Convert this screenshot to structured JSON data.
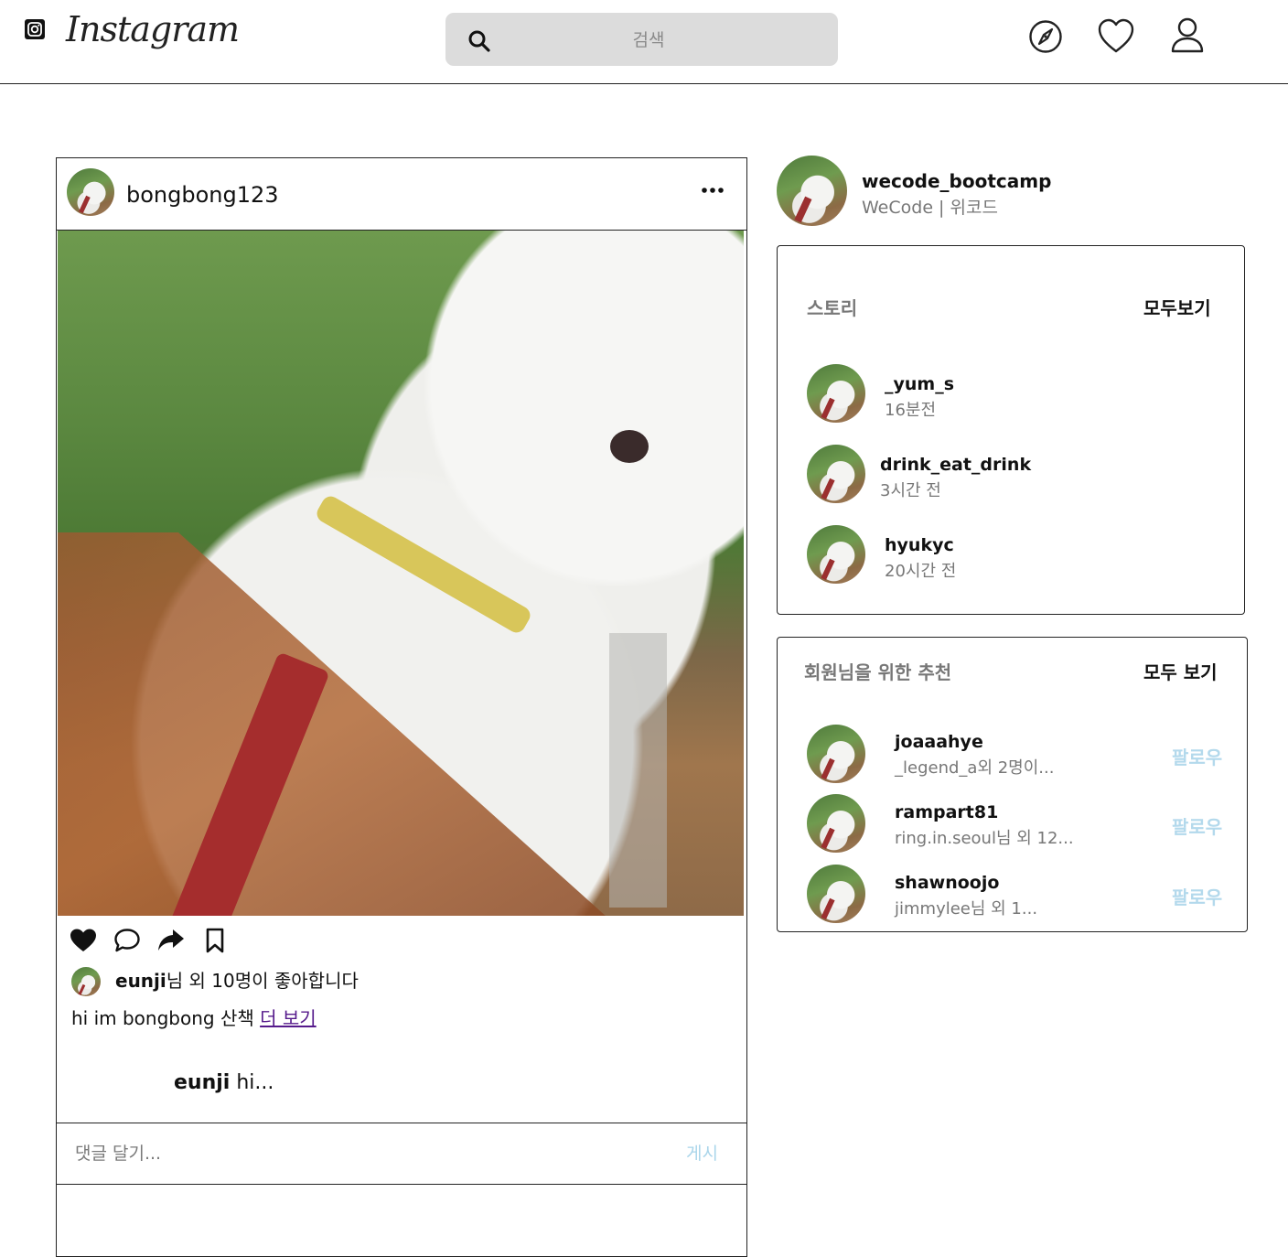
{
  "nav": {
    "logo": "Instagram",
    "search_placeholder": "검색",
    "icons": [
      "instagram-glyph-icon",
      "search-icon",
      "compass-icon",
      "heart-icon",
      "user-icon"
    ]
  },
  "post": {
    "username": "bongbong123",
    "liked_by": "eunji",
    "likes_suffix": "님 외 10명이 좋아합니다",
    "caption": "hi im bongbong 산책 ",
    "more_link": "더 보기",
    "comment_user": "eunji",
    "comment_text": " hi...",
    "comment_placeholder": "댓글 달기...",
    "post_button": "게시"
  },
  "profile": {
    "username": "wecode_bootcamp",
    "display_name": "WeCode | 위코드"
  },
  "stories": {
    "title": "스토리",
    "see_all": "모두보기",
    "items": [
      {
        "name": "_yum_s",
        "time": "16분전"
      },
      {
        "name": "drink_eat_drink",
        "time": "3시간 전"
      },
      {
        "name": "hyukyc",
        "time": "20시간 전"
      }
    ]
  },
  "recommendations": {
    "title": "회원님을 위한 추천",
    "see_all": "모두 보기",
    "follow_label": "팔로우",
    "items": [
      {
        "name": "joaaahye",
        "detail": "_legend_a외 2명이..."
      },
      {
        "name": "rampart81",
        "detail": "ring.in.seoul님 외 12..."
      },
      {
        "name": "shawnoojo",
        "detail": "jimmylee님 외 1..."
      }
    ]
  },
  "colors": {
    "border": "#222222",
    "search_bg": "#dcdcdc",
    "follow_blue": "#b3d9ec",
    "muted_text": "#777777",
    "link_purple": "#551a8b"
  }
}
